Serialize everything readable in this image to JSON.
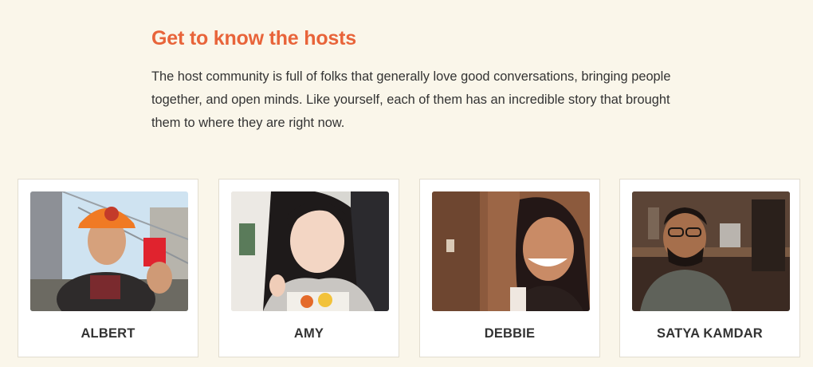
{
  "hosts_section": {
    "heading": "Get to know the hosts",
    "description": "The host community is full of folks that generally love good conversations, bringing people together, and open minds. Like yourself, each of them has an incredible story that brought them to where they are right now."
  },
  "hosts": [
    {
      "name": "ALBERT"
    },
    {
      "name": "AMY"
    },
    {
      "name": "DEBBIE"
    },
    {
      "name": "SATYA KAMDAR"
    }
  ],
  "colors": {
    "background": "#faf6ea",
    "heading": "#e8643a",
    "text": "#333333",
    "card": "#ffffff"
  }
}
